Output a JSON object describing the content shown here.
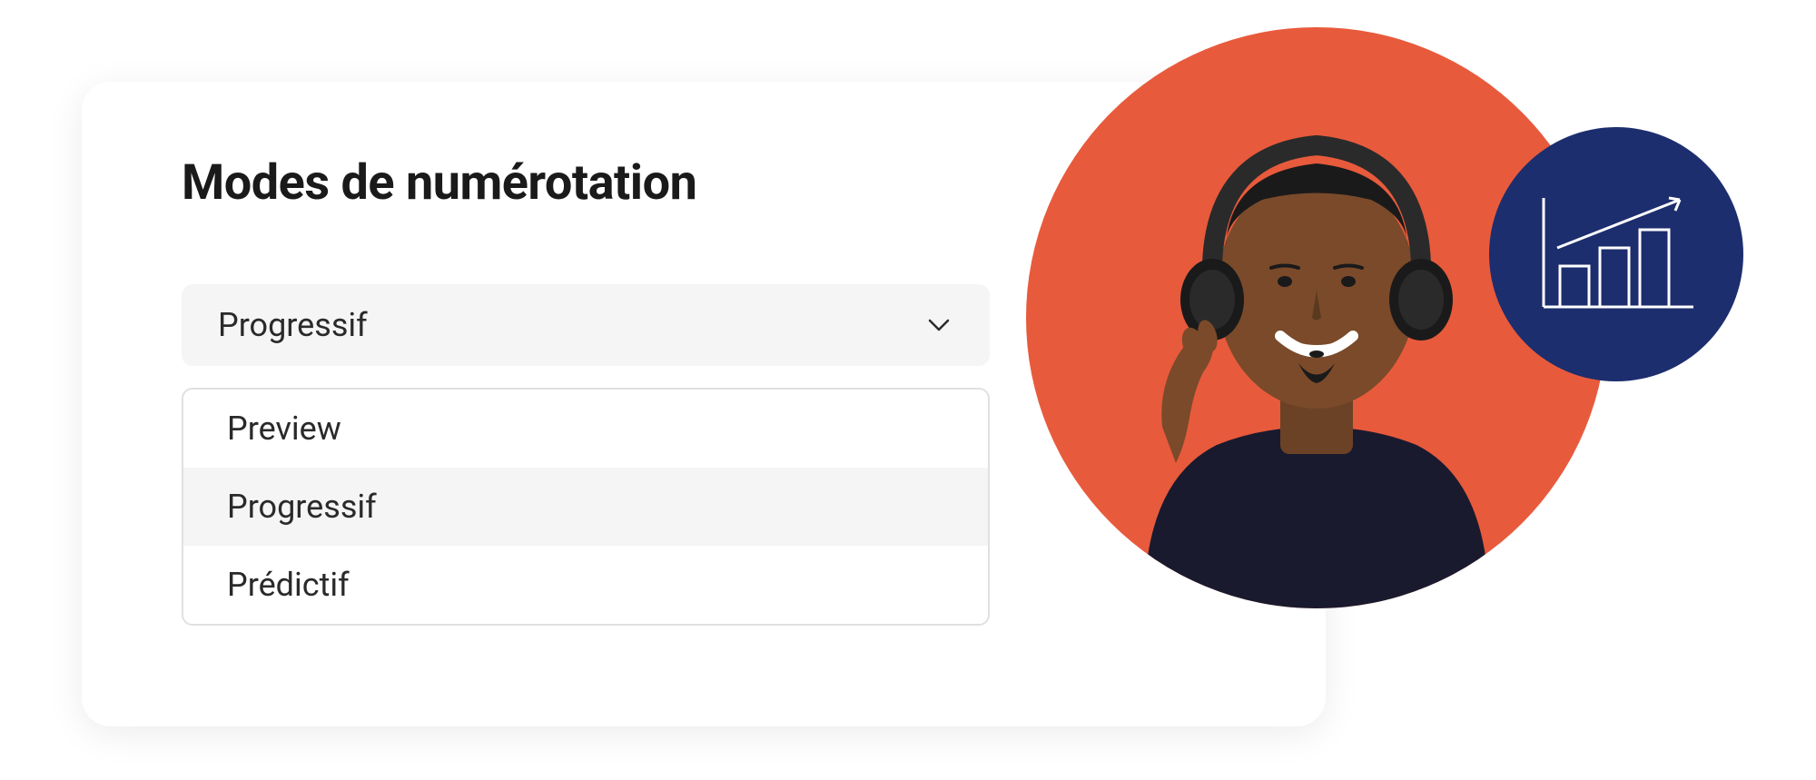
{
  "heading": "Modes de numérotation",
  "dropdown": {
    "selected": "Progressif",
    "options": [
      {
        "label": "Preview",
        "highlighted": false
      },
      {
        "label": "Progressif",
        "highlighted": true
      },
      {
        "label": "Prédictif",
        "highlighted": false
      }
    ]
  },
  "colors": {
    "avatar_bg": "#E85A3C",
    "badge_bg": "#1C2E6E"
  },
  "icons": {
    "chevron": "chevron-down-icon",
    "chart": "growth-chart-icon",
    "avatar": "agent-headset-avatar"
  }
}
